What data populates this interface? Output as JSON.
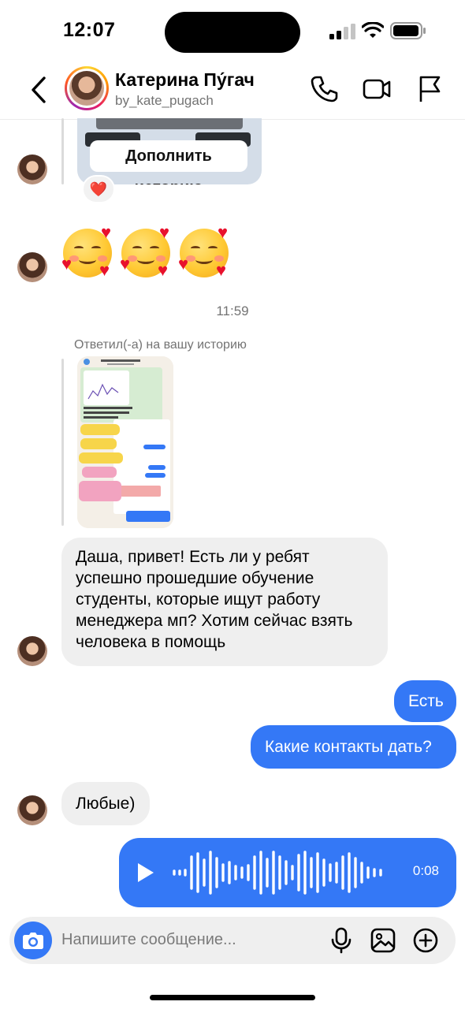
{
  "status_bar": {
    "time": "12:07"
  },
  "header": {
    "name": "Катерина Пу́гач",
    "username": "by_kate_pugach",
    "icons": [
      "chevron-left-icon",
      "phone-icon",
      "video-icon",
      "flag-icon"
    ]
  },
  "messages": {
    "story_button": "Дополнить историю",
    "story_reaction": "❤️",
    "timestamp": "11:59",
    "reply_label": "Ответил(-а) на вашу историю",
    "incoming_1": "Даша, привет! Есть ли у ребят успешно прошедшие обучение студенты, которые ищут работу менеджера мп? Хотим сейчас взять человека в помощь",
    "outgoing_1": "Есть",
    "outgoing_2": "Какие контакты дать?",
    "incoming_2": "Любые)",
    "voice_duration": "0:08"
  },
  "composer": {
    "placeholder": "Напишите сообщение..."
  },
  "colors": {
    "accent": "#3478f6",
    "incoming_bubble": "#efefef",
    "secondary_text": "#737373"
  }
}
